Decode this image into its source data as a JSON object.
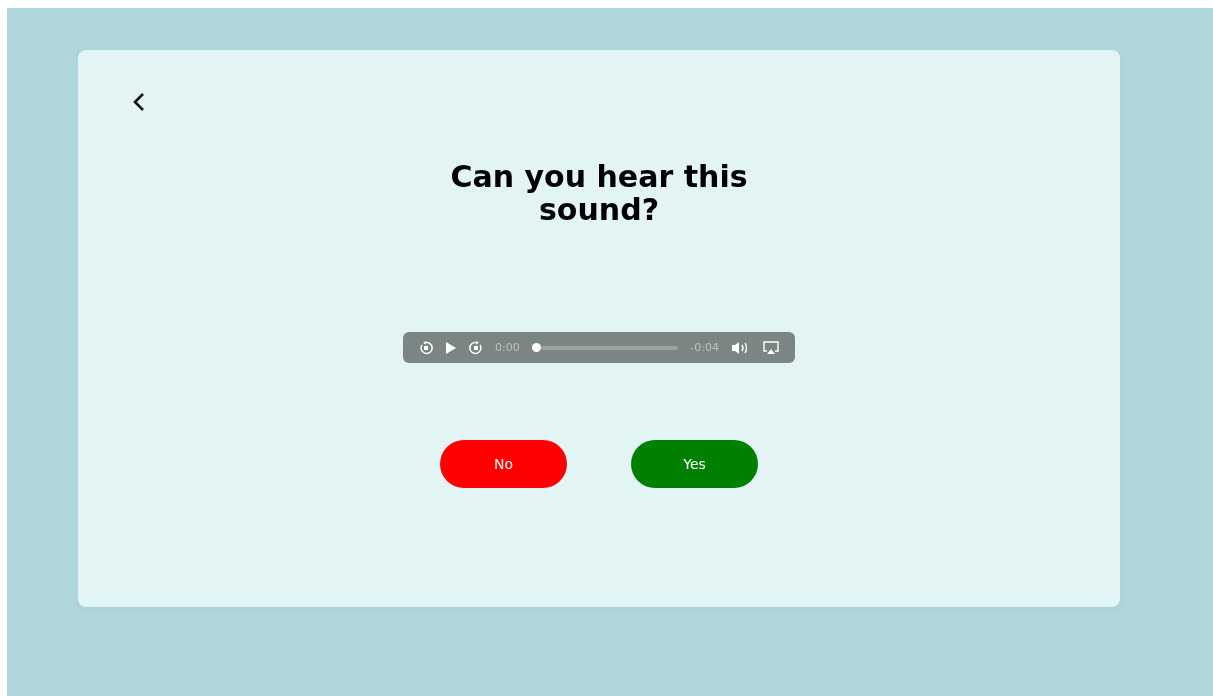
{
  "title": "Can you hear this sound?",
  "player": {
    "current_time": "0:00",
    "remaining_time": "-0:04",
    "level": 0
  },
  "buttons": [
    {
      "label": "No",
      "kind": "no"
    },
    {
      "label": "Yes",
      "kind": "yes"
    }
  ]
}
